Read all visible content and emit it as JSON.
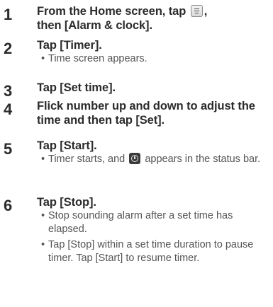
{
  "steps": [
    {
      "number": "1",
      "instruction_pre": "From the Home screen, tap",
      "instruction_post": ",",
      "instruction_line2": "then [Alarm & clock]."
    },
    {
      "number": "2",
      "instruction": "Tap [Timer].",
      "bullets": [
        "Time screen appears."
      ]
    },
    {
      "number": "3",
      "instruction": "Tap [Set time]."
    },
    {
      "number": "4",
      "instruction": "Flick number up and down to adjust the time and then tap [Set]."
    },
    {
      "number": "5",
      "instruction": "Tap [Start].",
      "bullet_pre": "Timer starts, and",
      "bullet_post": "appears in the status bar."
    },
    {
      "number": "6",
      "instruction": "Tap [Stop].",
      "bullets": [
        "Stop sounding alarm after a set time has elapsed.",
        "Tap [Stop] within a set time duration to pause timer. Tap [Start] to resume timer."
      ]
    }
  ],
  "icons": {
    "menu": "menu-icon",
    "timer": "timer-status-icon"
  }
}
